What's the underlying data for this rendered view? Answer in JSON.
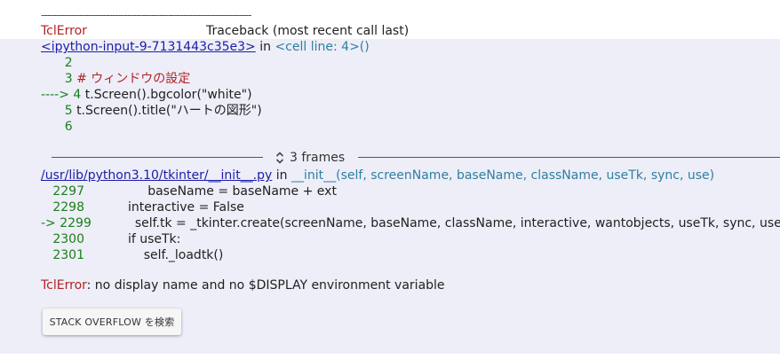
{
  "traceback": {
    "dashes": "-----------------------------------------------------------------------",
    "error_type": "TclError",
    "header_title": "Traceback (most recent call last)",
    "cell_link": "<ipython-input-9-7131443c35e3>",
    "in_word": " in ",
    "cell_location": "<cell line: 4>()",
    "cell_lines": [
      {
        "num": "      2",
        "code": ""
      },
      {
        "num": "      3 ",
        "code": "# ウィンドウの設定"
      },
      {
        "num": "----> 4 ",
        "code": "t.Screen().bgcolor(\"white\")"
      },
      {
        "num": "      5 ",
        "code": "t.Screen().title(\"ハートの図形\")"
      },
      {
        "num": "      6",
        "code": ""
      }
    ],
    "frames_label": "3 frames",
    "file_link": "/usr/lib/python3.10/tkinter/__init__.py",
    "func_signature": "__init__(self, screenName, baseName, className, useTk, sync, use)",
    "file_lines": [
      {
        "num": "   2297 ",
        "code": "               baseName = baseName + ext"
      },
      {
        "num": "   2298 ",
        "code": "          interactive = False"
      },
      {
        "num": "-> 2299 ",
        "code": "          self.tk = _tkinter.create(screenName, baseName, className, interactive, wantobjects, useTk, sync, use)"
      },
      {
        "num": "   2300 ",
        "code": "          if useTk:"
      },
      {
        "num": "   2301 ",
        "code": "              self._loadtk()"
      }
    ],
    "error_message": ": no display name and no $DISPLAY environment variable"
  },
  "actions": {
    "stack_overflow_button": "STACK OVERFLOW を検索"
  },
  "colors": {
    "panel_bg": "#edeef8",
    "error_red": "#b22222",
    "line_number_green": "#1a7f1a",
    "link_blue": "#1c1ca8"
  }
}
